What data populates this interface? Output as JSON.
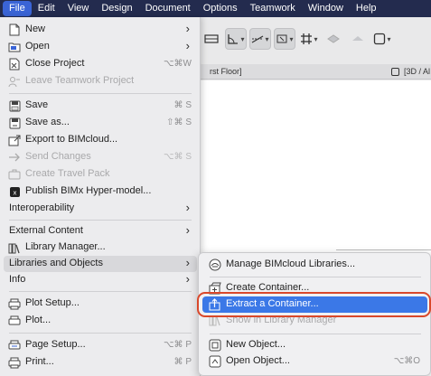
{
  "menubar": {
    "items": [
      "File",
      "Edit",
      "View",
      "Design",
      "Document",
      "Options",
      "Teamwork",
      "Window",
      "Help"
    ]
  },
  "toolbar": {
    "arrow": "▾"
  },
  "tabs": {
    "floor_tab": "rst Floor]",
    "view_3d_tab": "[3D / Al"
  },
  "file_menu": {
    "items": [
      {
        "label": "New",
        "icon": "new-document-icon",
        "submenu": true,
        "enabled": true
      },
      {
        "label": "Open",
        "icon": "open-folder-icon",
        "submenu": true,
        "enabled": true
      },
      {
        "label": "Close Project",
        "icon": "close-project-icon",
        "shortcut": "⌥⌘W",
        "enabled": true
      },
      {
        "label": "Leave Teamwork Project",
        "icon": "leave-teamwork-icon",
        "enabled": false
      },
      {
        "label": "Save",
        "icon": "save-icon",
        "shortcut": "⌘ S",
        "enabled": true
      },
      {
        "label": "Save as...",
        "icon": "save-as-icon",
        "shortcut": "⇧⌘ S",
        "enabled": true
      },
      {
        "label": "Export to BIMcloud...",
        "icon": "export-bimcloud-icon",
        "enabled": true
      },
      {
        "label": "Send Changes",
        "icon": "send-changes-icon",
        "shortcut": "⌥⌘ S",
        "enabled": false
      },
      {
        "label": "Create Travel Pack",
        "icon": "travel-pack-icon",
        "enabled": false
      },
      {
        "label": "Publish BIMx Hyper-model...",
        "icon": "bimx-icon",
        "enabled": true
      },
      {
        "label": "Interoperability",
        "submenu": true,
        "enabled": true
      },
      {
        "label": "External Content",
        "submenu": true,
        "enabled": true
      },
      {
        "label": "Library Manager...",
        "icon": "library-manager-icon",
        "enabled": true
      },
      {
        "label": "Libraries and Objects",
        "submenu": true,
        "enabled": true,
        "highlighted": true
      },
      {
        "label": "Info",
        "submenu": true,
        "enabled": true
      },
      {
        "label": "Plot Setup...",
        "icon": "plot-setup-icon",
        "enabled": true
      },
      {
        "label": "Plot...",
        "icon": "plot-icon",
        "enabled": true
      },
      {
        "label": "Page Setup...",
        "icon": "page-setup-icon",
        "shortcut": "⌥⌘ P",
        "enabled": true
      },
      {
        "label": "Print...",
        "icon": "print-icon",
        "shortcut": "⌘ P",
        "enabled": true
      }
    ],
    "submenu_arrow": "›"
  },
  "libraries_submenu": {
    "items": [
      {
        "label": "Manage BIMcloud Libraries...",
        "icon": "bimcloud-libraries-icon",
        "enabled": true
      },
      {
        "label": "Create Container...",
        "icon": "create-container-icon",
        "enabled": true
      },
      {
        "label": "Extract a Container...",
        "icon": "extract-container-icon",
        "enabled": true,
        "selected": true
      },
      {
        "label": "Show in Library Manager",
        "icon": "show-library-icon",
        "enabled": false
      },
      {
        "label": "New Object...",
        "icon": "new-object-icon",
        "enabled": true
      },
      {
        "label": "Open Object...",
        "icon": "open-object-icon",
        "shortcut": "⌥⌘O",
        "enabled": true
      }
    ]
  },
  "colors": {
    "menubar_bg": "#232b4e",
    "active_menu": "#3a64d6",
    "selection": "#3b78e7",
    "callout": "#d9482b"
  }
}
